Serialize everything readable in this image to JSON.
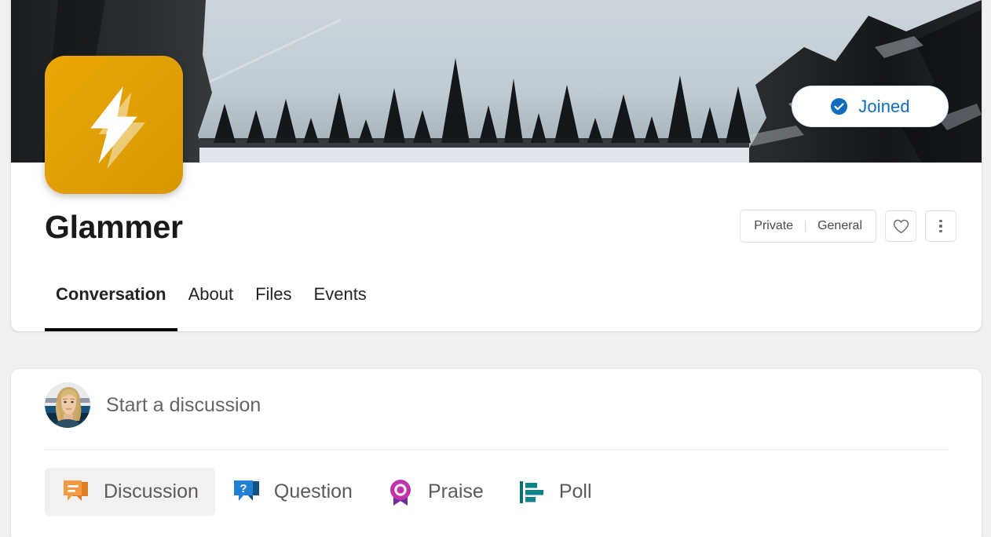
{
  "group": {
    "name": "Glammer",
    "avatar_icon": "lightning-bolt-icon",
    "avatar_color": "#e0a005",
    "banner_description": "winter mountain landscape with pine trees",
    "join_button": {
      "label": "Joined",
      "icon": "check-circle-icon",
      "accent_color": "#0f6cbd"
    },
    "meta": {
      "privacy": "Private",
      "classification": "General"
    },
    "actions": [
      {
        "name": "favorite",
        "icon": "heart-icon"
      },
      {
        "name": "more-options",
        "icon": "more-vertical-icon"
      }
    ]
  },
  "tabs": [
    {
      "label": "Conversation",
      "active": true
    },
    {
      "label": "About",
      "active": false
    },
    {
      "label": "Files",
      "active": false
    },
    {
      "label": "Events",
      "active": false
    }
  ],
  "composer": {
    "placeholder": "Start a discussion",
    "avatar_alt": "user profile photo",
    "post_types": [
      {
        "label": "Discussion",
        "icon": "discussion-bubble-icon",
        "color": "#ef8b32",
        "selected": true
      },
      {
        "label": "Question",
        "icon": "question-bubble-icon",
        "color": "#1f7ac7",
        "selected": false
      },
      {
        "label": "Praise",
        "icon": "praise-badge-icon",
        "color": "#c134ab",
        "selected": false
      },
      {
        "label": "Poll",
        "icon": "poll-bars-icon",
        "color": "#0f7b82",
        "selected": false
      }
    ]
  }
}
